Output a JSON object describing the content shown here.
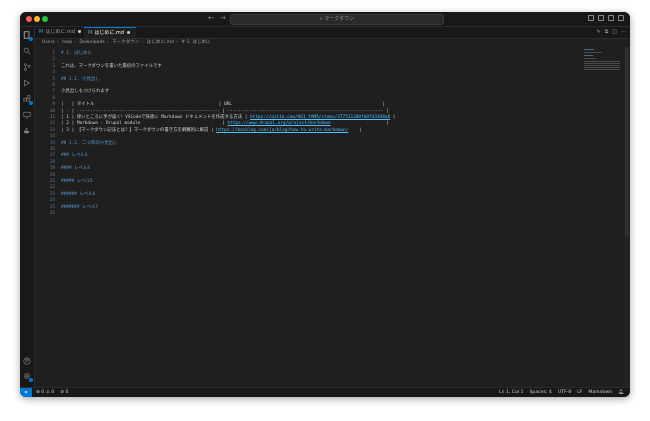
{
  "window": {
    "search_placeholder": "マークダウン"
  },
  "tabs": [
    {
      "label": "はじめに.md",
      "modified": true
    },
    {
      "label": "はじめに.md",
      "modified": true,
      "active": true
    }
  ],
  "breadcrumb": [
    "Users",
    "haqi",
    "Downloads",
    "マークダウン",
    "はじめに.md",
    "# 1. はじめに"
  ],
  "editor": {
    "lines": [
      {
        "n": "1",
        "text": "# 1. はじめに",
        "kind": "h"
      },
      {
        "n": "2",
        "text": "",
        "kind": "t"
      },
      {
        "n": "3",
        "text": "これは、マークダウンを書いた最初のファイルです",
        "kind": "t"
      },
      {
        "n": "4",
        "text": "",
        "kind": "t"
      },
      {
        "n": "5",
        "text": "## 1.1. 小見出し",
        "kind": "h"
      },
      {
        "n": "6",
        "text": "",
        "kind": "t"
      },
      {
        "n": "7",
        "text": "小見出しもつけられます",
        "kind": "t"
      },
      {
        "n": "8",
        "text": "",
        "kind": "t"
      },
      {
        "n": "9",
        "text": "|   | タイトル                                               | URL                                                         |",
        "kind": "tbl"
      },
      {
        "n": "10",
        "text": "| - | ------------------------------------------------------ | ----------------------------------------------------------- |",
        "kind": "tbl"
      },
      {
        "n": "11",
        "text": "| 1 | 痒いところに手が届く！VSCodeで快適に Markdown ドキュメントを作成する方法 | ",
        "kind": "tbl",
        "url": "https://qiita.com/K61_YAMA/items/377511300f60f43398a8",
        "tail": " |"
      },
      {
        "n": "12",
        "text": "| 2 | Markdown - Drupal module                               | ",
        "kind": "tbl",
        "url": "https://www.drupal.org/project/markdown",
        "tail": "                     |"
      },
      {
        "n": "13",
        "text": "| 3 | 【マークダウン記法とは？】マークダウンの書き方を網羅的に解説 | ",
        "kind": "tbl",
        "url": "https://backlog.com/ja/blog/how-to-write-markdown/",
        "tail": "    |"
      },
      {
        "n": "14",
        "text": "",
        "kind": "t"
      },
      {
        "n": "15",
        "text": "## 1.2. 二つ目の小見出し",
        "kind": "h"
      },
      {
        "n": "16",
        "text": "",
        "kind": "t"
      },
      {
        "n": "17",
        "text": "### レベル3",
        "kind": "h"
      },
      {
        "n": "18",
        "text": "",
        "kind": "t"
      },
      {
        "n": "19",
        "text": "#### レベル4",
        "kind": "h"
      },
      {
        "n": "20",
        "text": "",
        "kind": "t"
      },
      {
        "n": "21",
        "text": "##### レベル5",
        "kind": "h"
      },
      {
        "n": "22",
        "text": "",
        "kind": "t"
      },
      {
        "n": "23",
        "text": "###### レベル6",
        "kind": "h"
      },
      {
        "n": "24",
        "text": "",
        "kind": "t"
      },
      {
        "n": "25",
        "text": "####### レベル7",
        "kind": "h"
      },
      {
        "n": "26",
        "text": "",
        "kind": "t"
      }
    ]
  },
  "statusbar": {
    "problems": "⊗ 0 ⚠ 0",
    "ports": "⊘ 0",
    "position": "Ln 1, Col 1",
    "spaces": "Spaces: 4",
    "encoding": "UTF-8",
    "eol": "LF",
    "language": "Markdown"
  },
  "colors": {
    "accent": "#0078d4",
    "heading": "#569cd6",
    "link": "#4fc1ff"
  }
}
